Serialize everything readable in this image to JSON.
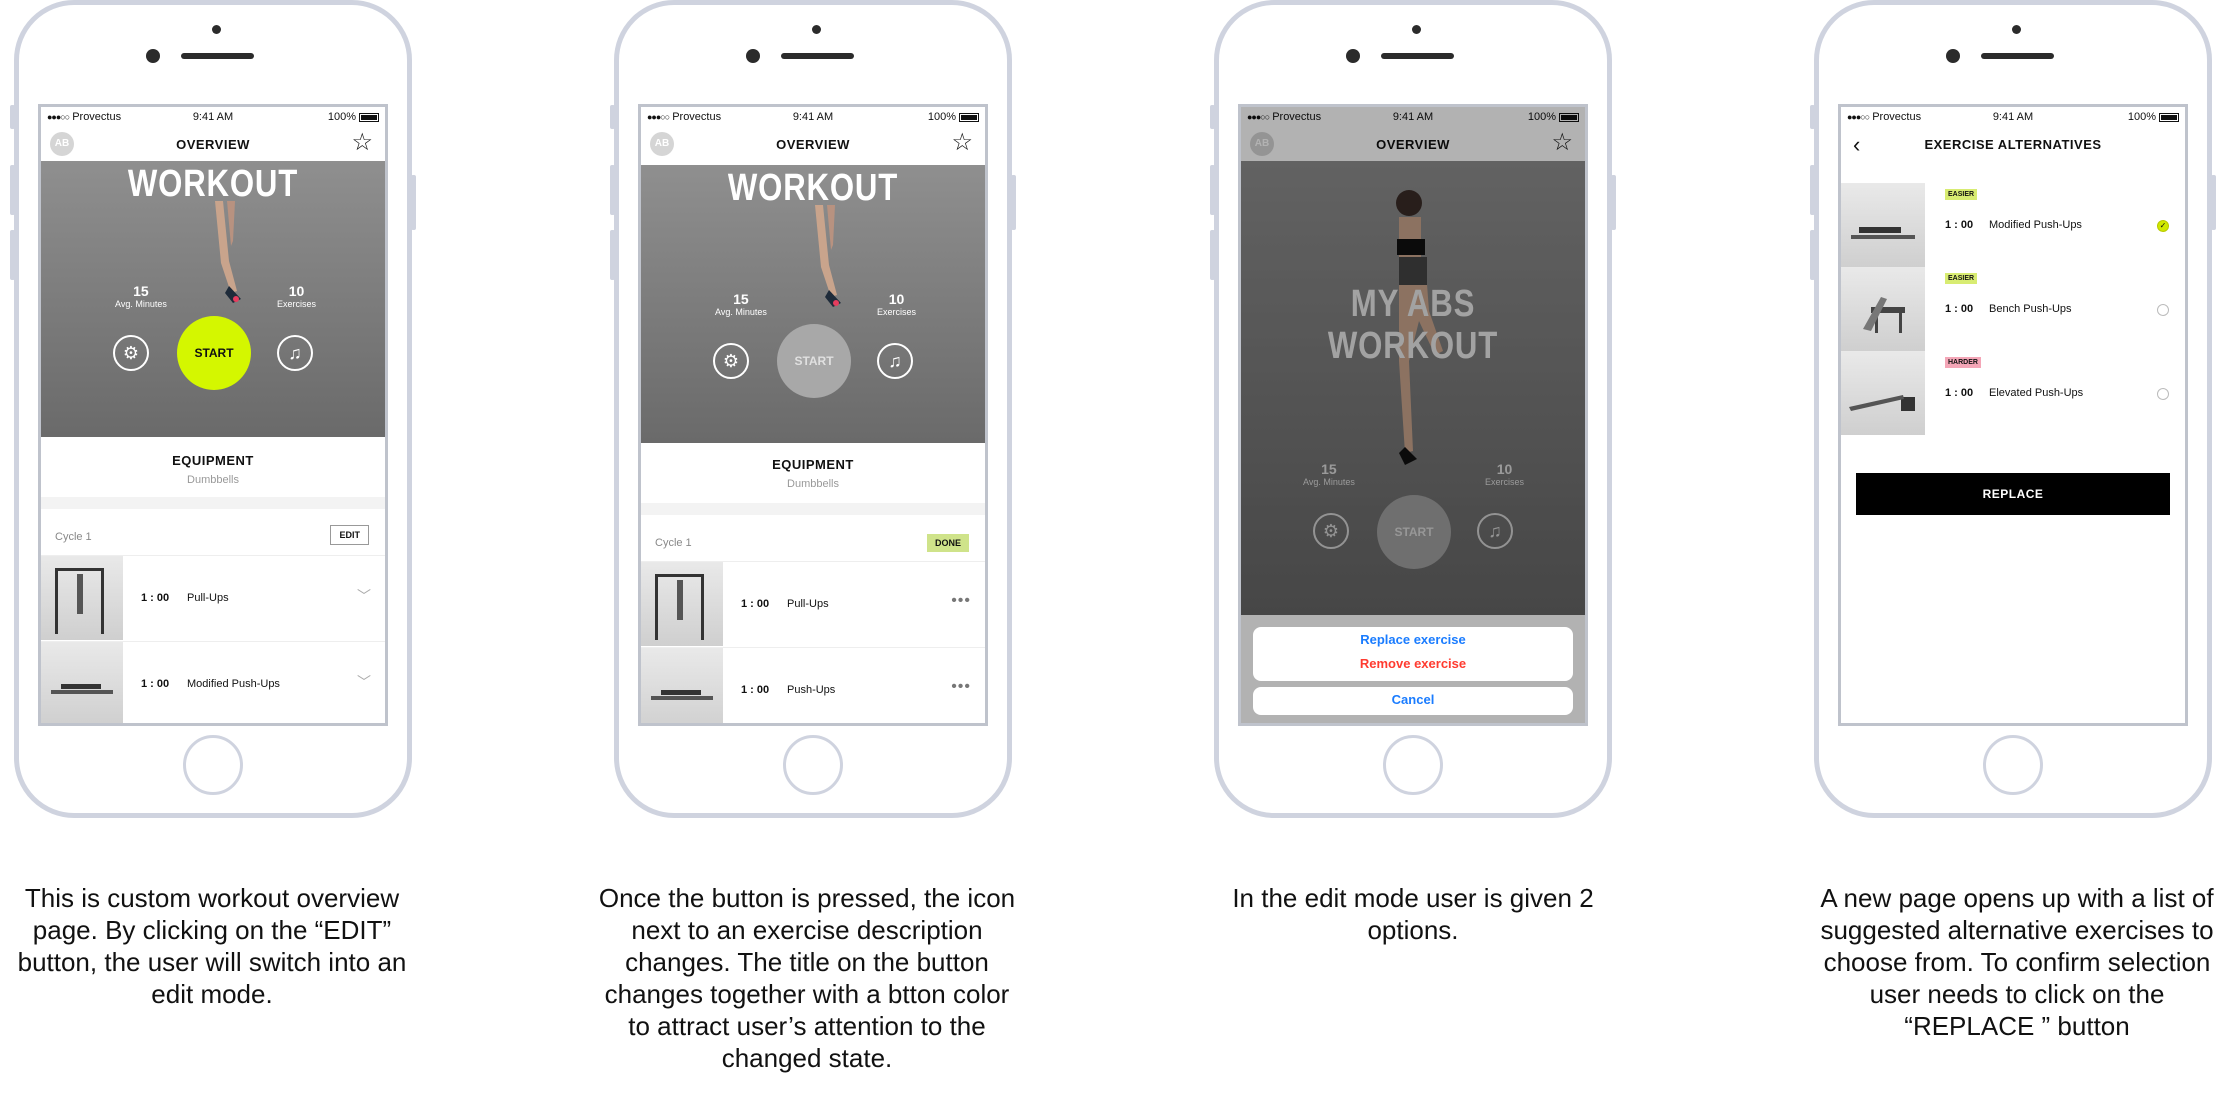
{
  "status_bar": {
    "carrier": "Provectus",
    "time": "9:41 AM",
    "battery": "100%"
  },
  "overview": {
    "avatar": "AB",
    "title": "OVERVIEW",
    "workout_title": "WORKOUT",
    "workout_title_full": "MY ABS WORKOUT",
    "minutes_value": "15",
    "minutes_label": "Avg. Minutes",
    "exercises_value": "10",
    "exercises_label": "Exercises",
    "start_label": "START",
    "equipment_title": "EQUIPMENT",
    "equipment_value": "Dumbbells",
    "cycle_label": "Cycle 1",
    "edit_label": "EDIT",
    "done_label": "DONE"
  },
  "exercises_screen1": [
    {
      "duration": "1 : 00",
      "name": "Pull-Ups"
    },
    {
      "duration": "1 : 00",
      "name": "Modified Push-Ups"
    }
  ],
  "exercises_screen2": [
    {
      "duration": "1 : 00",
      "name": "Pull-Ups"
    },
    {
      "duration": "1 : 00",
      "name": "Push-Ups"
    }
  ],
  "action_sheet": {
    "replace": "Replace exercise",
    "remove": "Remove exercise",
    "cancel": "Cancel"
  },
  "alternatives": {
    "title": "EXERCISE ALTERNATIVES",
    "replace_label": "REPLACE",
    "items": [
      {
        "tag": "EASIER",
        "duration": "1 : 00",
        "name": "Modified Push-Ups",
        "selected": true
      },
      {
        "tag": "EASIER",
        "duration": "1 : 00",
        "name": "Bench Push-Ups",
        "selected": false
      },
      {
        "tag": "HARDER",
        "duration": "1 : 00",
        "name": "Elevated Push-Ups",
        "selected": false
      }
    ]
  },
  "captions": {
    "c1": "This is custom workout overview page. By clicking on the “EDIT” button, the user will switch into an edit mode.",
    "c2": "Once the button is pressed, the icon next to an exercise description changes. The title on the button changes together with a btton color to attract user’s attention to the changed state.",
    "c3": "In the edit mode user is given 2 options.",
    "c4": "A new page opens up with a list of suggested alternative exercises to choose from. To confirm selection user needs to click on the “REPLACE ” button"
  },
  "colors": {
    "accent": "#d4f700",
    "done": "#cfe38a",
    "blue": "#1a7cff",
    "red": "#ff3b30"
  }
}
